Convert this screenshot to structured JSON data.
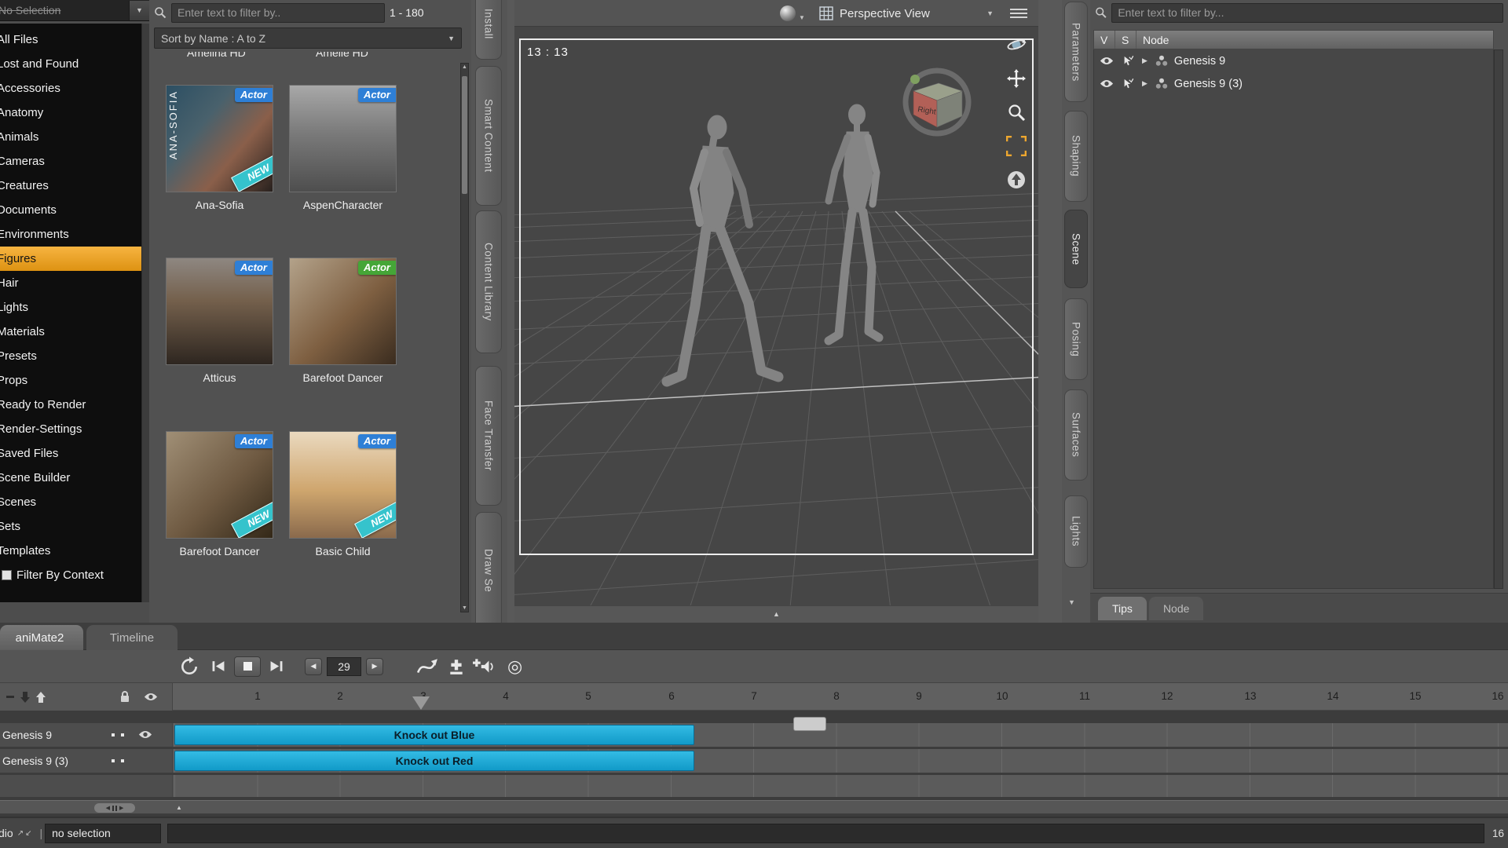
{
  "colors": {
    "accent_orange": "#e9a12b",
    "clip_cyan": "#1ea6d3",
    "badge_blue": "#2e7fd6",
    "badge_green": "#45a637",
    "ribbon_teal": "#35c3cc",
    "cube_face_red": "#b26057",
    "frame_tool_orange": "#eda72f"
  },
  "icons": {
    "chevron_down": "▼",
    "chevron_up": "▲",
    "arrow_left": "◀",
    "arrow_right": "▶",
    "expand_right": "▶",
    "record": "◎",
    "up_right_arrow": "↗",
    "down_left_arrow": "↙",
    "splitter_up": "▲"
  },
  "left_panel": {
    "dropdown_value": "No Selection",
    "selected_item": "Figures",
    "items": [
      "All Files",
      "Lost and Found",
      "Accessories",
      "Anatomy",
      "Animals",
      "Cameras",
      "Creatures",
      "Documents",
      "Environments",
      "Figures",
      "Hair",
      "Lights",
      "Materials",
      "Presets",
      "Props",
      "Ready to Render",
      "Render-Settings",
      "Saved Files",
      "Scene Builder",
      "Scenes",
      "Sets",
      "Templates",
      "Filter By Context"
    ]
  },
  "content_panel": {
    "filter_placeholder": "Enter text to filter by..",
    "range_label": "1 - 180",
    "sort_label": "Sort by Name : A to Z",
    "clipped_labels": [
      "Amelina HD",
      "Amelie HD"
    ],
    "new_label": "NEW",
    "products": [
      {
        "name": "Ana-Sofia",
        "badge": "Actor",
        "badge_color": "#2e7fd6",
        "is_new": true,
        "overlay_text": "ANA-SOFIA"
      },
      {
        "name": "AspenCharacter",
        "badge": "Actor",
        "badge_color": "#2e7fd6",
        "is_new": false
      },
      {
        "name": "Atticus",
        "badge": "Actor",
        "badge_color": "#2e7fd6",
        "is_new": false
      },
      {
        "name": "Barefoot Dancer",
        "badge": "Actor",
        "badge_color": "#45a637",
        "is_new": false
      },
      {
        "name": "Barefoot Dancer",
        "badge": "Actor",
        "badge_color": "#2e7fd6",
        "is_new": true
      },
      {
        "name": "Basic Child",
        "badge": "Actor",
        "badge_color": "#2e7fd6",
        "is_new": true
      }
    ]
  },
  "left_tab_strip": [
    "Install",
    "Smart Content",
    "Content Library",
    "Face Transfer",
    "Draw Se"
  ],
  "viewport": {
    "frame_time": "13 : 13",
    "view_selector": "Perspective View",
    "cube_face_label": "Right"
  },
  "right_tab_strip": [
    "Parameters",
    "Shaping",
    "Scene",
    "Posing",
    "Surfaces",
    "Lights"
  ],
  "scene_panel": {
    "filter_placeholder": "Enter text to filter by...",
    "columns": [
      "V",
      "S",
      "Node"
    ],
    "nodes": [
      {
        "label": "Genesis 9"
      },
      {
        "label": "Genesis 9 (3)"
      }
    ],
    "bottom_tabs": [
      "Tips",
      "Node"
    ]
  },
  "timeline": {
    "tabs": [
      "aniMate2",
      "Timeline"
    ],
    "frame_value": "29",
    "ruler": [
      "1",
      "2",
      "3",
      "4",
      "5",
      "6",
      "7",
      "8",
      "9",
      "10",
      "11",
      "12",
      "13",
      "14",
      "15",
      "16"
    ],
    "tracks": [
      {
        "label": "Genesis 9",
        "clip": "Knock out Blue"
      },
      {
        "label": "Genesis 9 (3)",
        "clip": "Knock out Red"
      }
    ],
    "status_prefix": "dio",
    "status_separator": "|",
    "status_selection": "no selection",
    "status_right": "16"
  }
}
